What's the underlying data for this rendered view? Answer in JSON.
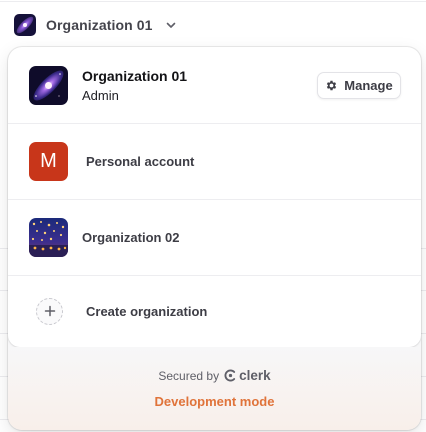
{
  "trigger": {
    "org_name": "Organization 01",
    "avatar_icon": "galaxy-avatar-icon",
    "chevron_icon": "chevron-down-icon"
  },
  "active_org": {
    "name": "Organization 01",
    "role": "Admin",
    "manage_label": "Manage",
    "manage_icon": "gear-icon"
  },
  "items": [
    {
      "label": "Personal account",
      "avatar_letter": "M",
      "avatar_color": "#c8361a"
    },
    {
      "label": "Organization 02",
      "avatar_icon": "lanterns-avatar-icon"
    }
  ],
  "create": {
    "label": "Create organization",
    "icon": "plus-icon"
  },
  "footer": {
    "secured_text": "Secured by",
    "brand": "clerk",
    "dev_mode": "Development mode",
    "dev_mode_color": "#e0733a"
  }
}
